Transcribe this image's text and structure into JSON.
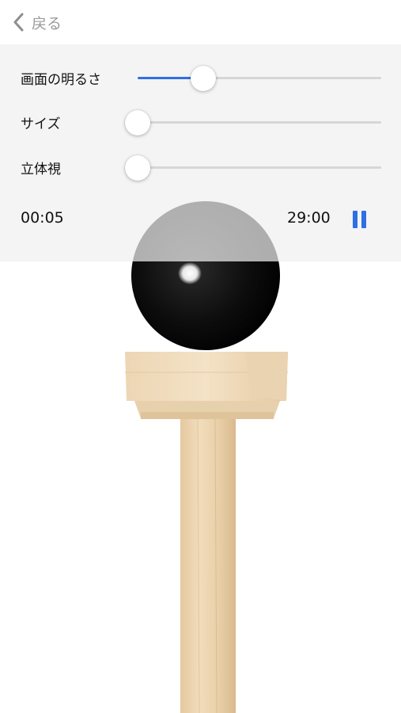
{
  "nav": {
    "back_label": "戻る"
  },
  "controls": {
    "brightness": {
      "label": "画面の明るさ",
      "value": 0.27
    },
    "size": {
      "label": "サイズ",
      "value": 0.0
    },
    "stereo": {
      "label": "立体視",
      "value": 0.0
    }
  },
  "timer": {
    "elapsed": "00:05",
    "total": "29:00"
  },
  "colors": {
    "accent": "#2f6fe4",
    "track": "#d6d6d6",
    "panel": "#f0f0f0"
  },
  "icons": {
    "back": "chevron-left-icon",
    "pause": "pause-icon"
  }
}
